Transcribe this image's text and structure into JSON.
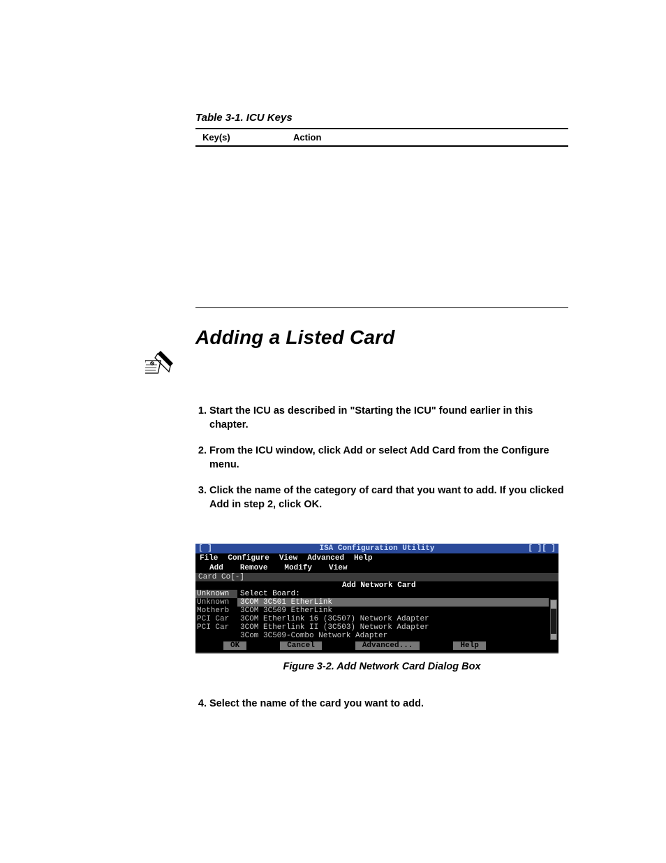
{
  "table": {
    "caption": "Table 3-1.  ICU Keys",
    "headers": {
      "col1": "Key(s)",
      "col2": "Action"
    }
  },
  "section": {
    "title": "Adding a Listed Card"
  },
  "steps": {
    "s1": "Start the ICU as described in \"Starting the ICU\" found earlier in this chapter.",
    "s2": "From the ICU window, click Add or select Add Card from the Configure menu.",
    "s3": "Click the name of the category of card that you want to add. If you clicked Add in step 2, click OK.",
    "s4": "Select the name of the card you want to add."
  },
  "figure": {
    "caption": "Figure 3-2.  Add Network Card Dialog Box"
  },
  "dos": {
    "titlebar": {
      "left": "[ ]",
      "title": "ISA Configuration Utility",
      "right": "[ ][ ]"
    },
    "menubar": {
      "file": "File",
      "configure": "Configure",
      "view": "View",
      "advanced": "Advanced",
      "help": "Help"
    },
    "submenu": {
      "add": "Add",
      "remove": "Remove",
      "modify": "Modify",
      "view": "View"
    },
    "card_line": "Card Co[-]",
    "inner_title": "Add Network Card",
    "left_col": {
      "i0": "Unknown",
      "i1": "Unknown",
      "i2": "Motherb",
      "i3": "PCI Car",
      "i4": "PCI Car"
    },
    "select_label": "Select Board:",
    "list": {
      "r0": "3COM 3C501 EtherLink",
      "r1": "3COM 3C509 EtherLink",
      "r2": "3COM Etherlink 16 (3C507) Network Adapter",
      "r3": "3COM Etherlink II (3C503) Network Adapter",
      "r4": "3Com 3C509-Combo Network Adapter"
    },
    "buttons": {
      "ok": "OK",
      "cancel": "Cancel",
      "advanced": "Advanced...",
      "help": "Help"
    }
  }
}
